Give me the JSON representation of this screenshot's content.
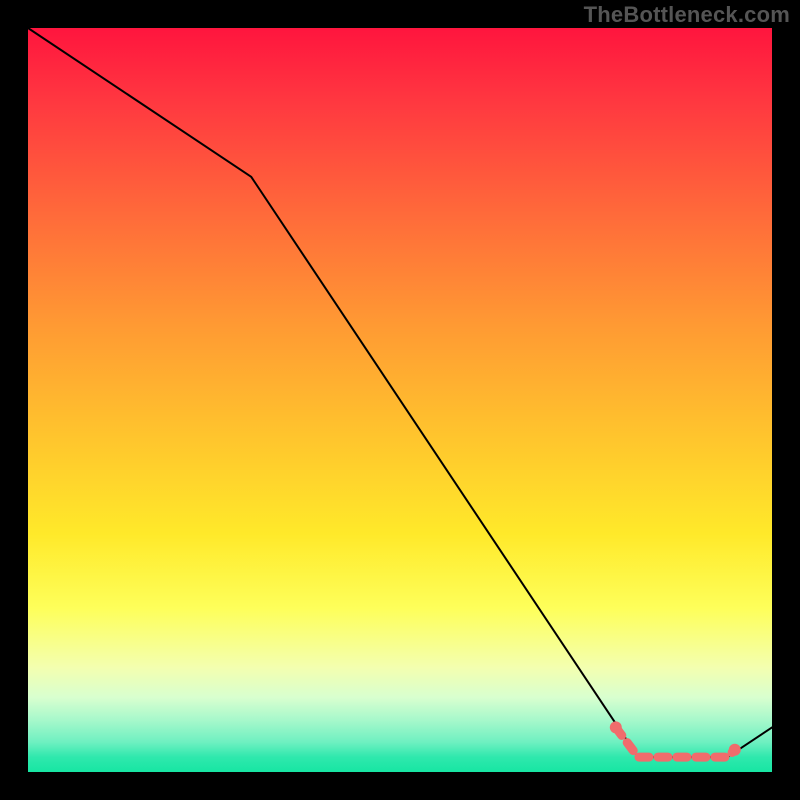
{
  "watermark": "TheBottleneck.com",
  "chart_data": {
    "type": "line",
    "title": "",
    "xlabel": "",
    "ylabel": "",
    "ylim": [
      0,
      100
    ],
    "xlim": [
      0,
      100
    ],
    "series": [
      {
        "name": "bottleneck-curve",
        "x": [
          0,
          30,
          82,
          94,
          100
        ],
        "values": [
          100,
          80,
          2,
          2,
          6
        ],
        "color": "#000000",
        "linewidth": 2
      }
    ],
    "highlight_segment": {
      "name": "optimal-range",
      "x": [
        79,
        82,
        94,
        95
      ],
      "values": [
        6,
        2,
        2,
        3
      ],
      "color": "#f06c6c",
      "linewidth": 9,
      "endpoint_dots": true
    }
  },
  "colors": {
    "page_bg": "#000000",
    "watermark": "#555555",
    "gradient_top": "#ff153e",
    "gradient_mid": "#ffe92a",
    "gradient_bottom": "#17e6a3",
    "curve": "#000000",
    "highlight": "#f06c6c"
  }
}
